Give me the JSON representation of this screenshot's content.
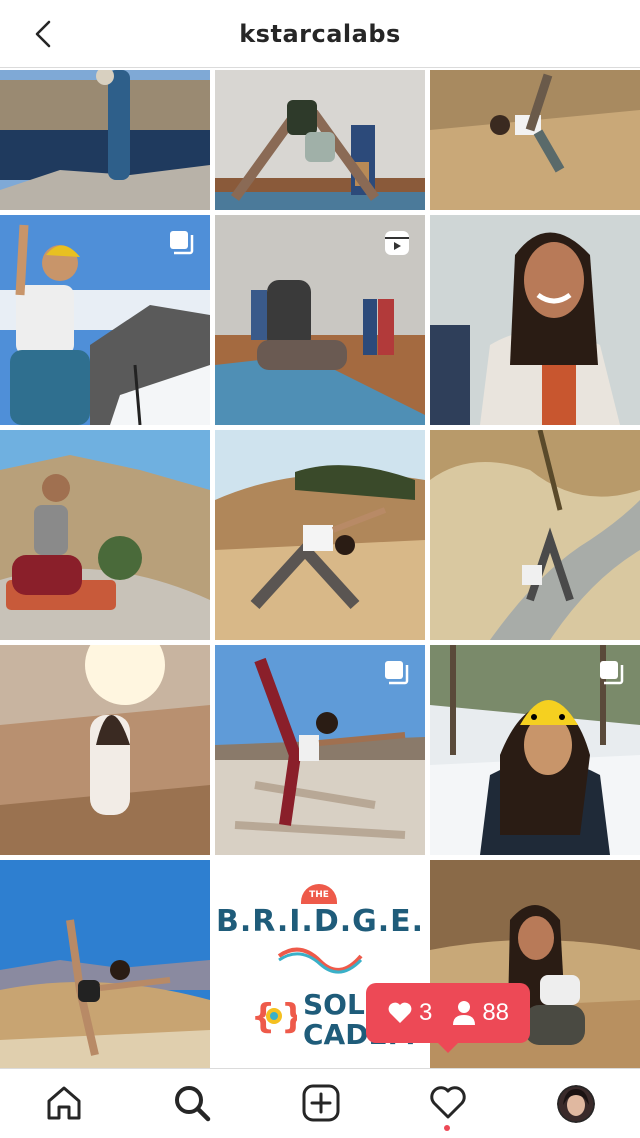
{
  "header": {
    "title": "kstarcalabs",
    "back_icon": "chevron-left-icon"
  },
  "grid": {
    "posts": [
      {
        "row": 1,
        "col": 1,
        "subject": "tree-pose-lake",
        "badge": null
      },
      {
        "row": 1,
        "col": 2,
        "subject": "downward-dog-studio",
        "badge": null
      },
      {
        "row": 1,
        "col": 3,
        "subject": "yoga-dry-grass",
        "badge": null
      },
      {
        "row": 2,
        "col": 1,
        "subject": "mountain-snow-pose",
        "badge": "carousel-icon"
      },
      {
        "row": 2,
        "col": 2,
        "subject": "mat-stretch-studio",
        "badge": "reels-icon"
      },
      {
        "row": 2,
        "col": 3,
        "subject": "portrait-smiling",
        "badge": null
      },
      {
        "row": 3,
        "col": 1,
        "subject": "seated-desert-rocks",
        "badge": null
      },
      {
        "row": 3,
        "col": 2,
        "subject": "warrior-pose-hill",
        "badge": null
      },
      {
        "row": 3,
        "col": 3,
        "subject": "trail-pose",
        "badge": null
      },
      {
        "row": 4,
        "col": 1,
        "subject": "sunburst-field",
        "badge": null
      },
      {
        "row": 4,
        "col": 2,
        "subject": "standing-split-salt-flat",
        "badge": "carousel-icon"
      },
      {
        "row": 4,
        "col": 3,
        "subject": "snow-pikachu-hat",
        "badge": "carousel-icon"
      },
      {
        "row": 5,
        "col": 1,
        "subject": "badlands-pose",
        "badge": null
      },
      {
        "row": 5,
        "col": 2,
        "subject": "bridge-sol-logo",
        "badge": null
      },
      {
        "row": 5,
        "col": 3,
        "subject": "seated-golden-grass",
        "badge": null
      }
    ],
    "bridge_logo": {
      "the_label": "THE",
      "title": "B.R.I.D.G.E.",
      "sol_line1": "SOL",
      "sol_line2": "CADEM"
    }
  },
  "notification": {
    "likes_count": "3",
    "followers_count": "88",
    "like_icon": "heart-icon",
    "follower_icon": "person-icon"
  },
  "tabbar": {
    "items": [
      {
        "name": "home",
        "icon": "home-icon"
      },
      {
        "name": "search",
        "icon": "search-icon"
      },
      {
        "name": "create",
        "icon": "plus-square-icon"
      },
      {
        "name": "activity",
        "icon": "heart-icon"
      },
      {
        "name": "profile",
        "icon": "avatar"
      }
    ]
  },
  "colors": {
    "notification": "#ed4956",
    "text": "#262626",
    "divider": "#dbdbdb"
  }
}
